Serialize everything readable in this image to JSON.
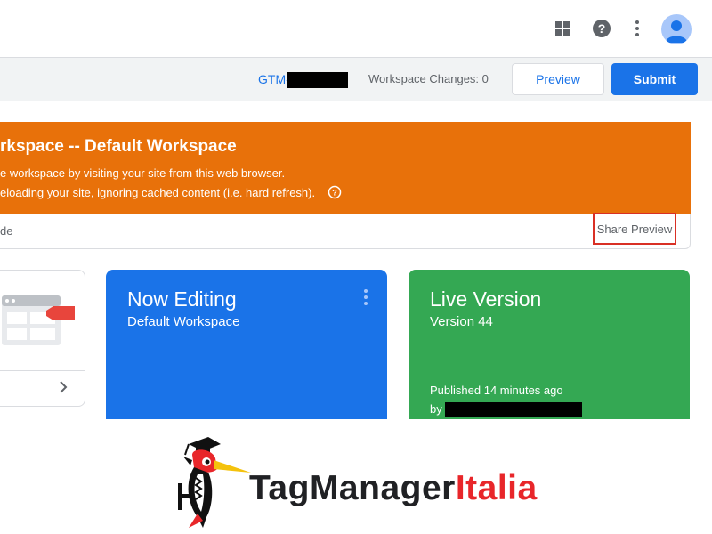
{
  "header": {
    "icons": [
      "apps-icon",
      "help-icon",
      "more-vert-icon",
      "account-avatar"
    ]
  },
  "subheader": {
    "container_id_prefix": "GTM-",
    "workspace_changes": "Workspace Changes: 0",
    "preview_label": "Preview",
    "submit_label": "Submit"
  },
  "preview_banner": {
    "title": "rkspace -- Default Workspace",
    "line1": "e workspace by visiting your site from this web browser.",
    "line2": "eloading your site, ignoring cached content (i.e. hard refresh).",
    "footer_text": "de",
    "share_preview_label": "Share Preview"
  },
  "cards": {
    "now_editing": {
      "title": "Now Editing",
      "subtitle": "Default Workspace"
    },
    "live_version": {
      "title": "Live Version",
      "subtitle": "Version 44",
      "published": "Published 14 minutes ago",
      "by_label": "by"
    }
  },
  "brand": {
    "name_main": "TagManager",
    "name_accent": "Italia"
  },
  "colors": {
    "primary_blue": "#1a73e8",
    "banner_orange": "#e8710a",
    "live_green": "#34a853",
    "highlight_red": "#d93025",
    "brand_red": "#e8262a"
  }
}
